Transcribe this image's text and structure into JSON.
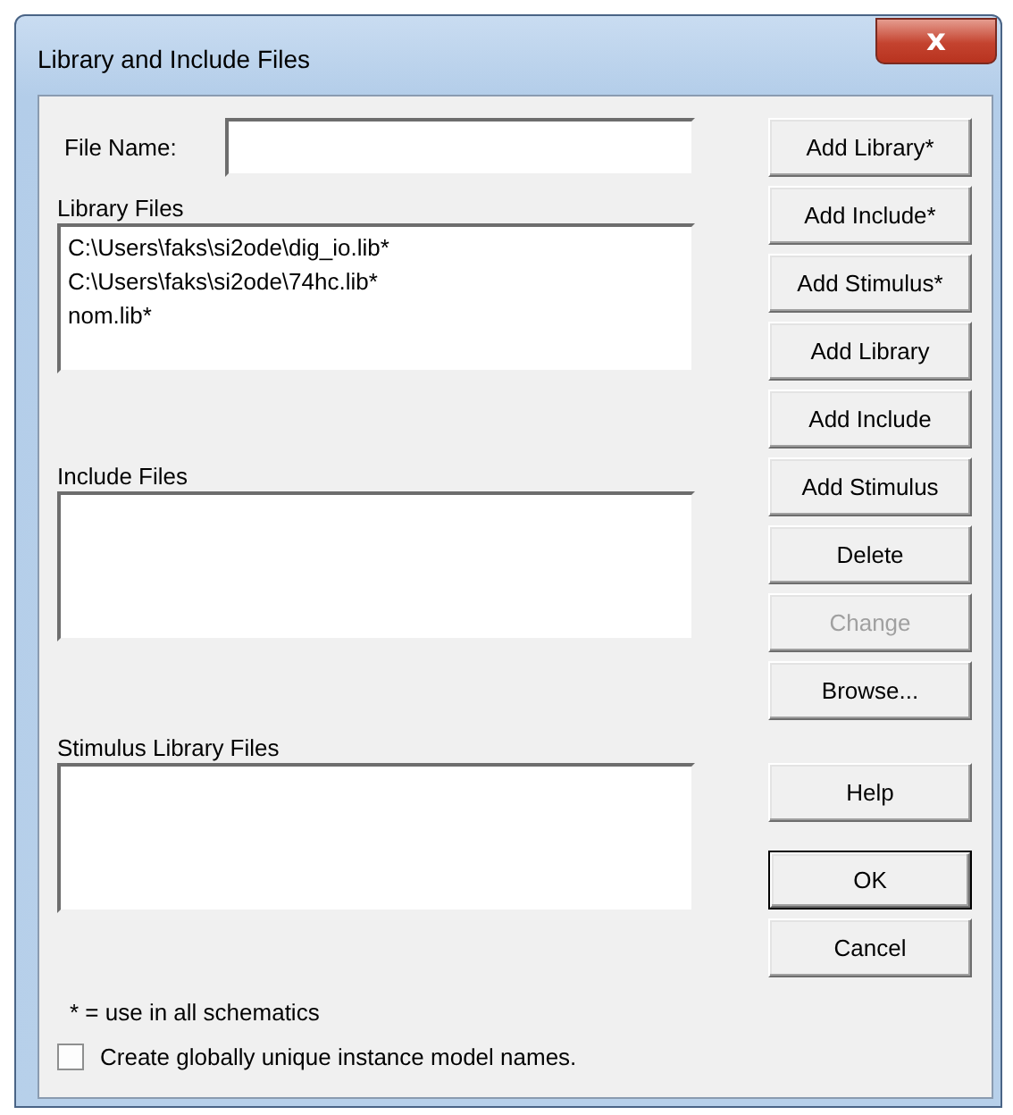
{
  "window": {
    "title": "Library and Include Files",
    "close": "x"
  },
  "file_name": {
    "label": "File Name:"
  },
  "lists": [
    {
      "label": "Library Files",
      "items": [
        "C:\\Users\\faks\\si2ode\\dig_io.lib*",
        "C:\\Users\\faks\\si2ode\\74hc.lib*",
        "nom.lib*"
      ]
    },
    {
      "label": "Include Files"
    },
    {
      "label": "Stimulus Library Files"
    }
  ],
  "button_groups": [
    [
      {
        "label": "Add Library*",
        "disabled": false,
        "default": false
      },
      {
        "label": "Add Include*",
        "disabled": false,
        "default": false
      },
      {
        "label": "Add Stimulus*",
        "disabled": false,
        "default": false
      },
      {
        "label": "Add Library",
        "disabled": false,
        "default": false
      },
      {
        "label": "Add Include",
        "disabled": false,
        "default": false
      },
      {
        "label": "Add Stimulus",
        "disabled": false,
        "default": false
      },
      {
        "label": "Delete",
        "disabled": false,
        "default": false
      },
      {
        "label": "Change",
        "disabled": true,
        "default": false
      },
      {
        "label": "Browse...",
        "disabled": false,
        "default": false
      }
    ],
    [
      {
        "label": "Help",
        "disabled": false,
        "default": false
      }
    ],
    [
      {
        "label": "OK",
        "disabled": false,
        "default": true
      },
      {
        "label": "Cancel",
        "disabled": false,
        "default": false
      }
    ]
  ],
  "footnote": "* = use in all schematics",
  "checkbox": {
    "label": "Create globally unique instance model names.",
    "checked": false
  }
}
